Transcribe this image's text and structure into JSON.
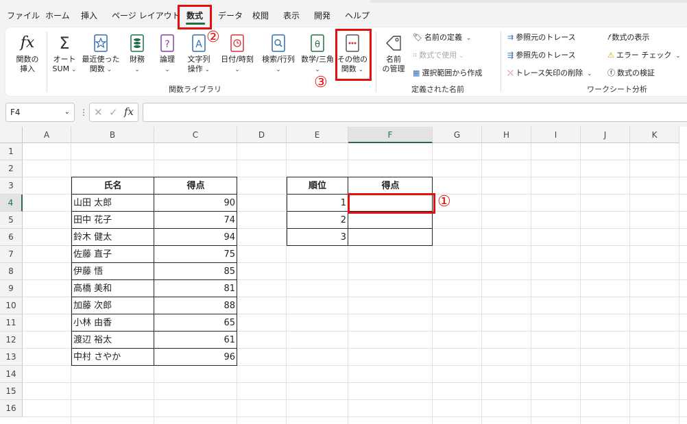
{
  "menu": {
    "tabs": [
      "ファイル",
      "ホーム",
      "挿入",
      "ページ レイアウト",
      "数式",
      "データ",
      "校閲",
      "表示",
      "開発",
      "ヘルプ"
    ],
    "active": "数式"
  },
  "ribbon": {
    "insert_fn": [
      "関数の",
      "挿入"
    ],
    "autosum": [
      "オート",
      "SUM"
    ],
    "recent": [
      "最近使った",
      "関数"
    ],
    "financial": "財務",
    "logical": "論理",
    "text": [
      "文字列",
      "操作"
    ],
    "datetime": "日付/時刻",
    "lookup": "検索/行列",
    "math": "数学/三角",
    "more": [
      "その他の",
      "関数"
    ],
    "group_library": "関数ライブラリ",
    "name_mgr": [
      "名前",
      "の管理"
    ],
    "define_name": "名前の定義",
    "use_in_formula": "数式で使用",
    "create_from_sel": "選択範囲から作成",
    "group_names": "定義された名前",
    "trace_prec": "参照元のトレース",
    "trace_dep": "参照先のトレース",
    "remove_arrows": "トレース矢印の削除",
    "show_formulas": "数式の表示",
    "error_check": "エラー チェック",
    "evaluate": "数式の検証",
    "group_audit": "ワークシート分析"
  },
  "formula_bar": {
    "name_box": "F4",
    "formula": ""
  },
  "grid": {
    "columns": [
      "A",
      "B",
      "C",
      "D",
      "E",
      "F",
      "G",
      "H",
      "I",
      "J",
      "K"
    ],
    "rows": [
      "1",
      "2",
      "3",
      "4",
      "5",
      "6",
      "7",
      "8",
      "9",
      "10",
      "11",
      "12",
      "13",
      "14",
      "15",
      "16"
    ],
    "selected_col": "F",
    "selected_row": "4"
  },
  "table1": {
    "headers": [
      "氏名",
      "得点"
    ],
    "rows": [
      [
        "山田 太郎",
        "90"
      ],
      [
        "田中 花子",
        "74"
      ],
      [
        "鈴木 健太",
        "94"
      ],
      [
        "佐藤 直子",
        "75"
      ],
      [
        "伊藤 悟",
        "85"
      ],
      [
        "高橋 美和",
        "81"
      ],
      [
        "加藤 次郎",
        "88"
      ],
      [
        "小林 由香",
        "65"
      ],
      [
        "渡辺 裕太",
        "61"
      ],
      [
        "中村 さやか",
        "96"
      ]
    ]
  },
  "table2": {
    "headers": [
      "順位",
      "得点"
    ],
    "rows": [
      [
        "1",
        ""
      ],
      [
        "2",
        ""
      ],
      [
        "3",
        ""
      ]
    ]
  },
  "annotations": {
    "m1": "①",
    "m2": "②",
    "m3": "③",
    "color": "#e11010"
  }
}
